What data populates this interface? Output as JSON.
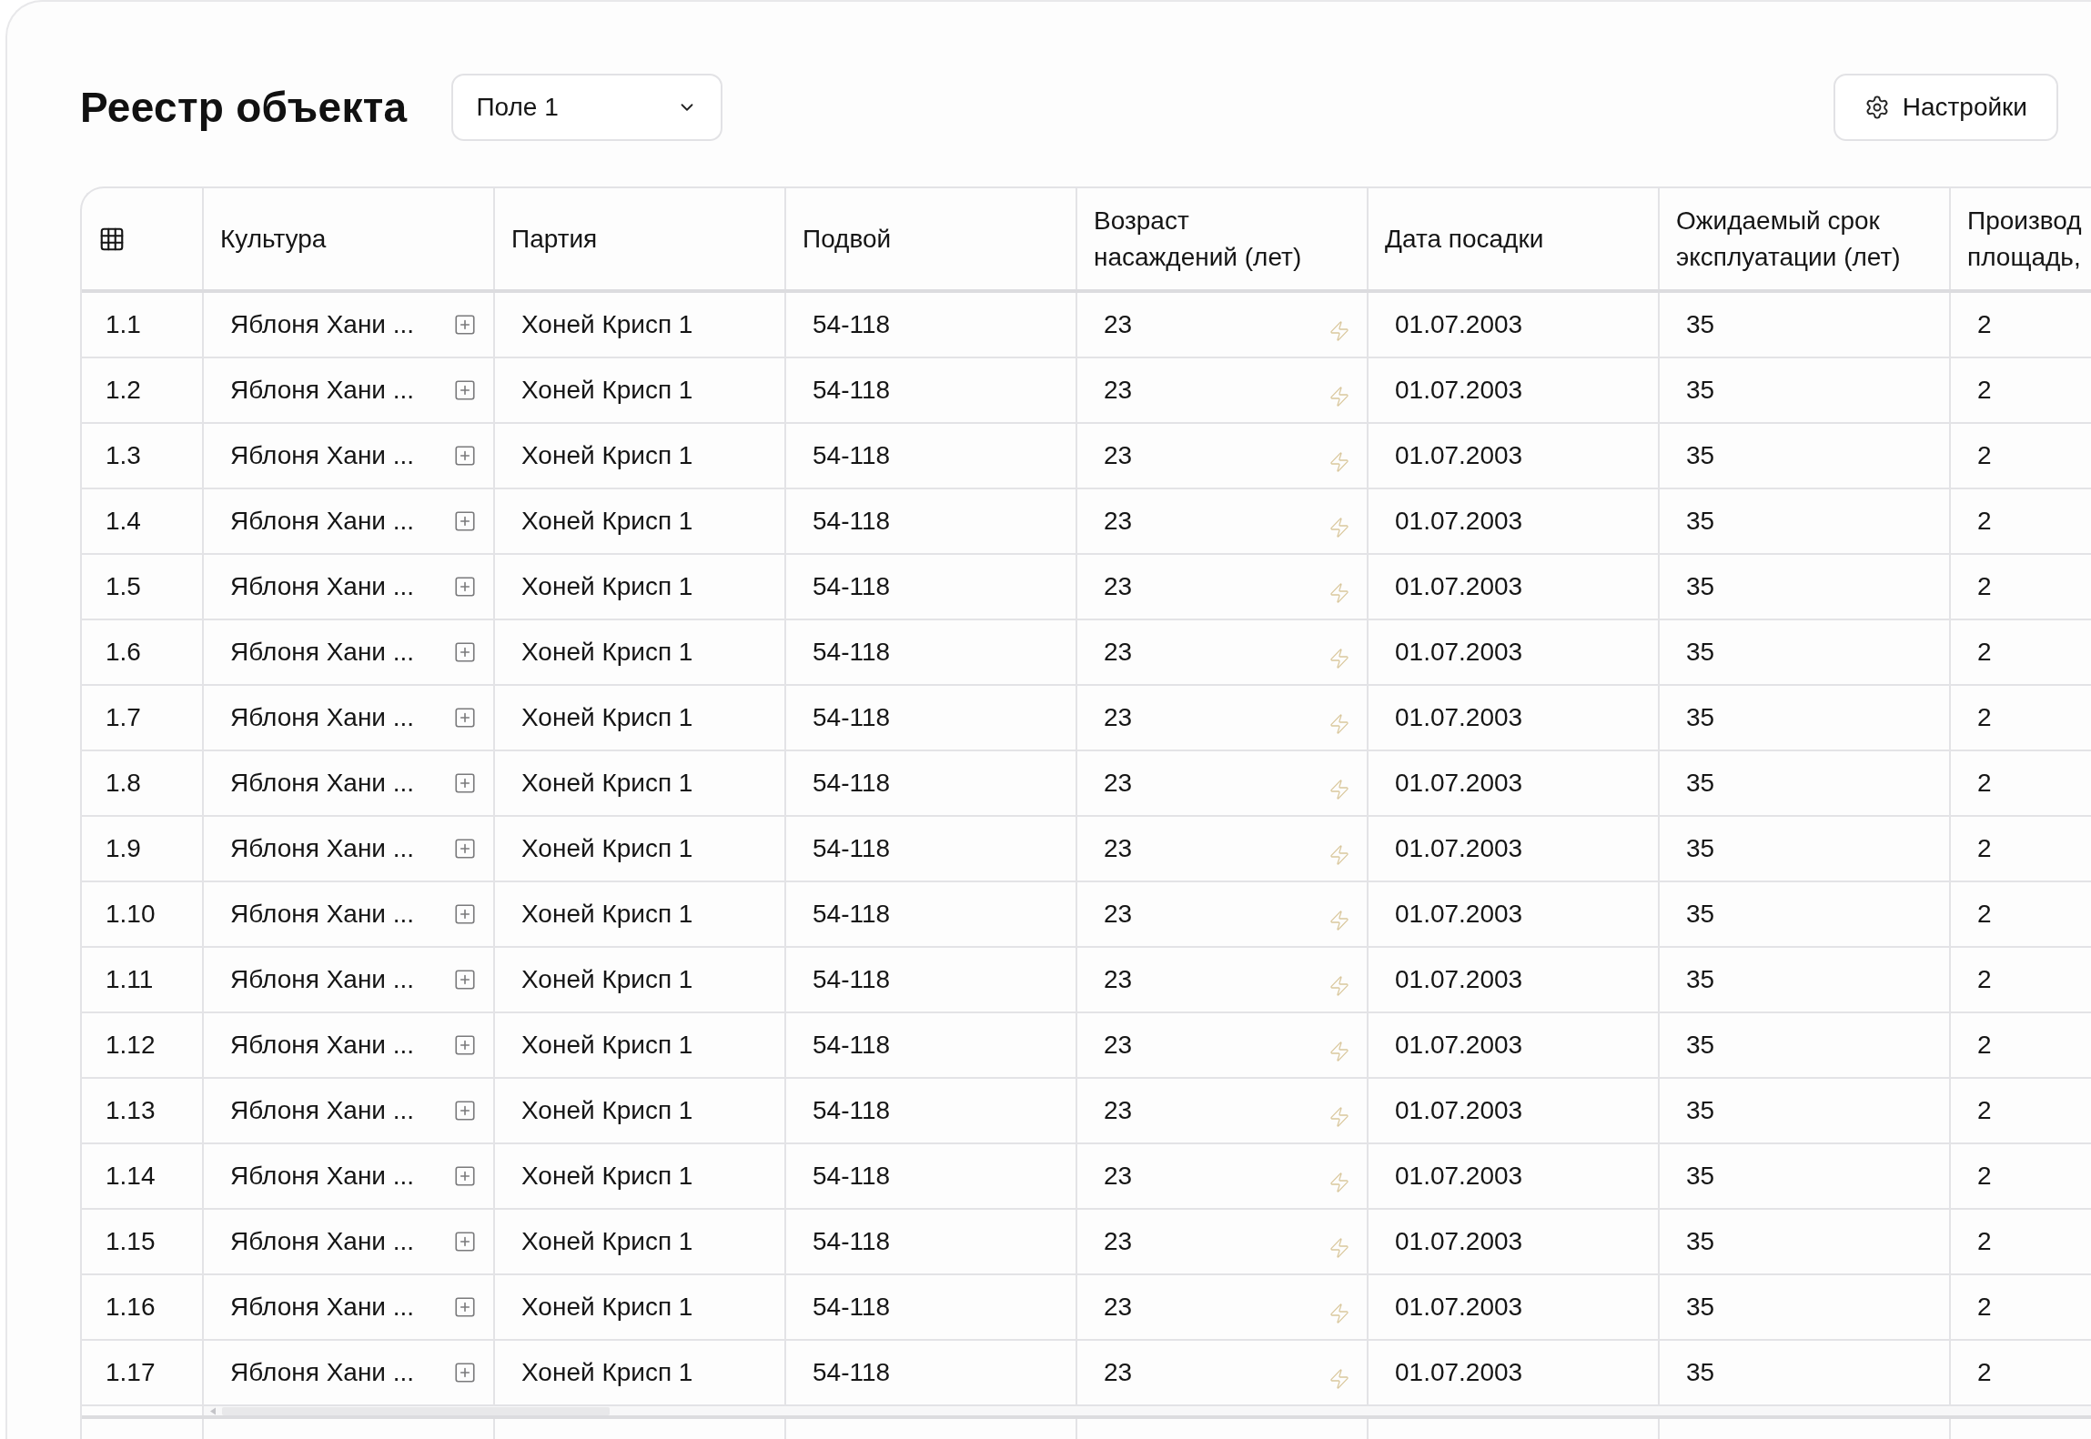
{
  "header": {
    "title": "Реестр объекта",
    "field_select": {
      "value": "Поле 1"
    },
    "settings_button": {
      "label": "Настройки"
    }
  },
  "table": {
    "columns": [
      {
        "kind": "index"
      },
      {
        "kind": "expand",
        "label": "Культура"
      },
      {
        "kind": "text",
        "label": "Партия"
      },
      {
        "kind": "text",
        "label": "Подвой"
      },
      {
        "kind": "calculated",
        "label": "Возраст насаждений (лет)"
      },
      {
        "kind": "text",
        "label": "Дата посадки"
      },
      {
        "kind": "text",
        "label": "Ожидаемый срок эксплуатации (лет)"
      },
      {
        "kind": "text",
        "label": "Производ площадь,"
      }
    ],
    "rows": [
      {
        "cells": [
          "1.1",
          "Яблоня Хани ...",
          "Хоней Крисп 1",
          "54-118",
          "23",
          "01.07.2003",
          "35",
          "2"
        ]
      },
      {
        "cells": [
          "1.2",
          "Яблоня Хани ...",
          "Хоней Крисп 1",
          "54-118",
          "23",
          "01.07.2003",
          "35",
          "2"
        ]
      },
      {
        "cells": [
          "1.3",
          "Яблоня Хани ...",
          "Хоней Крисп 1",
          "54-118",
          "23",
          "01.07.2003",
          "35",
          "2"
        ]
      },
      {
        "cells": [
          "1.4",
          "Яблоня Хани ...",
          "Хоней Крисп 1",
          "54-118",
          "23",
          "01.07.2003",
          "35",
          "2"
        ]
      },
      {
        "cells": [
          "1.5",
          "Яблоня Хани ...",
          "Хоней Крисп 1",
          "54-118",
          "23",
          "01.07.2003",
          "35",
          "2"
        ]
      },
      {
        "cells": [
          "1.6",
          "Яблоня Хани ...",
          "Хоней Крисп 1",
          "54-118",
          "23",
          "01.07.2003",
          "35",
          "2"
        ]
      },
      {
        "cells": [
          "1.7",
          "Яблоня Хани ...",
          "Хоней Крисп 1",
          "54-118",
          "23",
          "01.07.2003",
          "35",
          "2"
        ]
      },
      {
        "cells": [
          "1.8",
          "Яблоня Хани ...",
          "Хоней Крисп 1",
          "54-118",
          "23",
          "01.07.2003",
          "35",
          "2"
        ]
      },
      {
        "cells": [
          "1.9",
          "Яблоня Хани ...",
          "Хоней Крисп 1",
          "54-118",
          "23",
          "01.07.2003",
          "35",
          "2"
        ]
      },
      {
        "cells": [
          "1.10",
          "Яблоня Хани ...",
          "Хоней Крисп 1",
          "54-118",
          "23",
          "01.07.2003",
          "35",
          "2"
        ]
      },
      {
        "cells": [
          "1.11",
          "Яблоня Хани ...",
          "Хоней Крисп 1",
          "54-118",
          "23",
          "01.07.2003",
          "35",
          "2"
        ]
      },
      {
        "cells": [
          "1.12",
          "Яблоня Хани ...",
          "Хоней Крисп 1",
          "54-118",
          "23",
          "01.07.2003",
          "35",
          "2"
        ]
      },
      {
        "cells": [
          "1.13",
          "Яблоня Хани ...",
          "Хоней Крисп 1",
          "54-118",
          "23",
          "01.07.2003",
          "35",
          "2"
        ]
      },
      {
        "cells": [
          "1.14",
          "Яблоня Хани ...",
          "Хоней Крисп 1",
          "54-118",
          "23",
          "01.07.2003",
          "35",
          "2"
        ]
      },
      {
        "cells": [
          "1.15",
          "Яблоня Хани ...",
          "Хоней Крисп 1",
          "54-118",
          "23",
          "01.07.2003",
          "35",
          "2"
        ]
      },
      {
        "cells": [
          "1.16",
          "Яблоня Хани ...",
          "Хоней Крисп 1",
          "54-118",
          "23",
          "01.07.2003",
          "35",
          "2"
        ]
      },
      {
        "cells": [
          "1.17",
          "Яблоня Хани ...",
          "Хоней Крисп 1",
          "54-118",
          "23",
          "01.07.2003",
          "35",
          "2"
        ]
      }
    ]
  }
}
